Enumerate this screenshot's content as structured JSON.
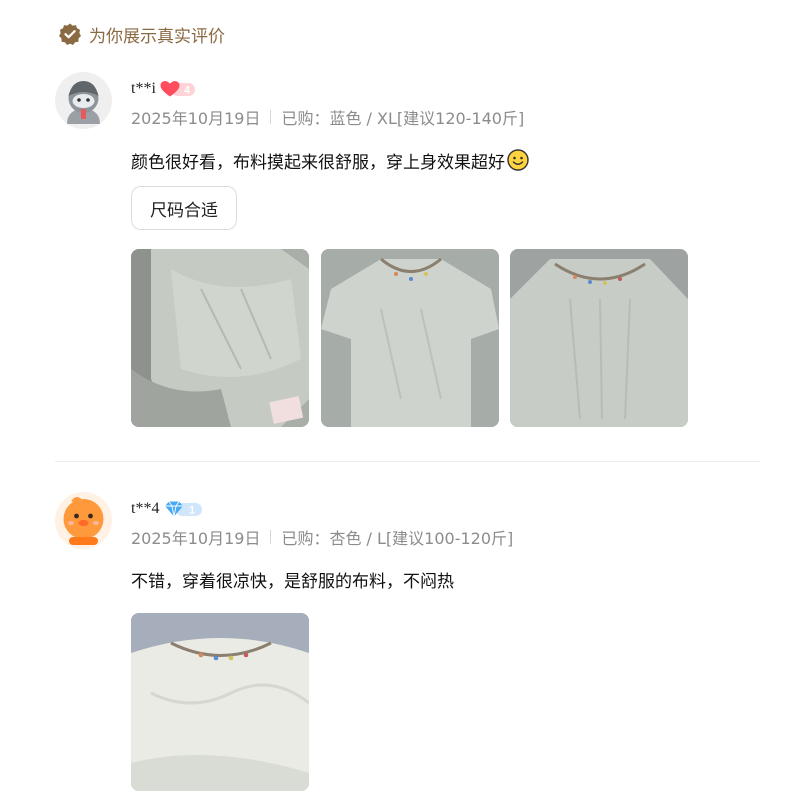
{
  "header": {
    "title": "为你展示真实评价",
    "icon": "verified-badge-icon",
    "color": "#8a6a43"
  },
  "reviews": [
    {
      "username": "t**i",
      "level": "4",
      "level_icon": "heart-level-icon",
      "date": "2025年10月19日",
      "purchase": "已购：蓝色 / XL[建议120-140斤]",
      "text": "颜色很好看，布料摸起来很舒服，穿上身效果超好",
      "emoji": "smiley-icon",
      "tag": "尺码合适",
      "photo_count": 3
    },
    {
      "username": "t**4",
      "level": "1",
      "level_icon": "diamond-level-icon",
      "date": "2025年10月19日",
      "purchase": "已购：杏色 / L[建议100-120斤]",
      "text": "不错，穿着很凉快，是舒服的布料，不闷热",
      "photo_count": 1
    }
  ],
  "colors": {
    "heart_badge": "#ff4d5e",
    "diamond_badge": "#4aa8f0",
    "meta_text": "#8c8c8c"
  }
}
